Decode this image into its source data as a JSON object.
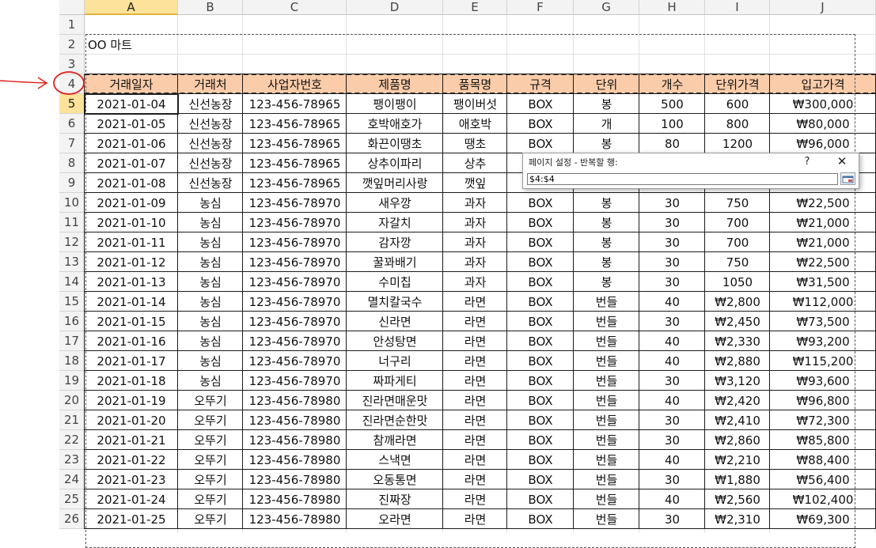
{
  "columns": [
    "A",
    "B",
    "C",
    "D",
    "E",
    "F",
    "G",
    "H",
    "I",
    "J"
  ],
  "rows": [
    "1",
    "2",
    "3",
    "4",
    "5",
    "6",
    "7",
    "8",
    "9",
    "10",
    "11",
    "12",
    "13",
    "14",
    "15",
    "16",
    "17",
    "18",
    "19",
    "20",
    "21",
    "22",
    "23",
    "24",
    "25",
    "26"
  ],
  "title_cell": "OO 마트",
  "table_headers": [
    "거래일자",
    "거래처",
    "사업자번호",
    "제품명",
    "품목명",
    "규격",
    "단위",
    "개수",
    "단위가격",
    "입고가격"
  ],
  "table_rows": [
    [
      "2021-01-04",
      "신선농장",
      "123-456-78965",
      "팽이팽이",
      "팽이버섯",
      "BOX",
      "봉",
      "500",
      "600",
      "₩300,000"
    ],
    [
      "2021-01-05",
      "신선농장",
      "123-456-78965",
      "호박애호가",
      "애호박",
      "BOX",
      "개",
      "100",
      "800",
      "₩80,000"
    ],
    [
      "2021-01-06",
      "신선농장",
      "123-456-78965",
      "화끈이땡초",
      "땡초",
      "BOX",
      "봉",
      "80",
      "1200",
      "₩96,000"
    ],
    [
      "2021-01-07",
      "신선농장",
      "123-456-78965",
      "상추이파리",
      "상추",
      "",
      "",
      "",
      "",
      ""
    ],
    [
      "2021-01-08",
      "신선농장",
      "123-456-78965",
      "깻잎머리사랑",
      "깻잎",
      "",
      "",
      "",
      "",
      ""
    ],
    [
      "2021-01-09",
      "농심",
      "123-456-78970",
      "새우깡",
      "과자",
      "BOX",
      "봉",
      "30",
      "750",
      "₩22,500"
    ],
    [
      "2021-01-10",
      "농심",
      "123-456-78970",
      "자갈치",
      "과자",
      "BOX",
      "봉",
      "30",
      "700",
      "₩21,000"
    ],
    [
      "2021-01-11",
      "농심",
      "123-456-78970",
      "감자깡",
      "과자",
      "BOX",
      "봉",
      "30",
      "700",
      "₩21,000"
    ],
    [
      "2021-01-12",
      "농심",
      "123-456-78970",
      "꿀꽈배기",
      "과자",
      "BOX",
      "봉",
      "30",
      "750",
      "₩22,500"
    ],
    [
      "2021-01-13",
      "농심",
      "123-456-78970",
      "수미칩",
      "과자",
      "BOX",
      "봉",
      "30",
      "1050",
      "₩31,500"
    ],
    [
      "2021-01-14",
      "농심",
      "123-456-78970",
      "멸치칼국수",
      "라면",
      "BOX",
      "번들",
      "40",
      "₩2,800",
      "₩112,000"
    ],
    [
      "2021-01-15",
      "농심",
      "123-456-78970",
      "신라면",
      "라면",
      "BOX",
      "번들",
      "30",
      "₩2,450",
      "₩73,500"
    ],
    [
      "2021-01-16",
      "농심",
      "123-456-78970",
      "안성탕면",
      "라면",
      "BOX",
      "번들",
      "40",
      "₩2,330",
      "₩93,200"
    ],
    [
      "2021-01-17",
      "농심",
      "123-456-78970",
      "너구리",
      "라면",
      "BOX",
      "번들",
      "40",
      "₩2,880",
      "₩115,200"
    ],
    [
      "2021-01-18",
      "농심",
      "123-456-78970",
      "짜파게티",
      "라면",
      "BOX",
      "번들",
      "30",
      "₩3,120",
      "₩93,600"
    ],
    [
      "2021-01-19",
      "오뚜기",
      "123-456-78980",
      "진라면매운맛",
      "라면",
      "BOX",
      "번들",
      "40",
      "₩2,420",
      "₩96,800"
    ],
    [
      "2021-01-20",
      "오뚜기",
      "123-456-78980",
      "진라면순한맛",
      "라면",
      "BOX",
      "번들",
      "30",
      "₩2,410",
      "₩72,300"
    ],
    [
      "2021-01-21",
      "오뚜기",
      "123-456-78980",
      "참깨라면",
      "라면",
      "BOX",
      "번들",
      "30",
      "₩2,860",
      "₩85,800"
    ],
    [
      "2021-01-22",
      "오뚜기",
      "123-456-78980",
      "스낵면",
      "라면",
      "BOX",
      "번들",
      "40",
      "₩2,210",
      "₩88,400"
    ],
    [
      "2021-01-23",
      "오뚜기",
      "123-456-78980",
      "오동통면",
      "라면",
      "BOX",
      "번들",
      "30",
      "₩1,880",
      "₩56,400"
    ],
    [
      "2021-01-24",
      "오뚜기",
      "123-456-78980",
      "진짜장",
      "라면",
      "BOX",
      "번들",
      "40",
      "₩2,560",
      "₩102,400"
    ],
    [
      "2021-01-25",
      "오뚜기",
      "123-456-78980",
      "오라면",
      "라면",
      "BOX",
      "번들",
      "30",
      "₩2,310",
      "₩69,300"
    ]
  ],
  "dialog": {
    "title": "페이지 설정 - 반복할 행:",
    "help_label": "?",
    "close_label": "✕",
    "range_value": "$4:$4",
    "collapse_icon": "range-collapse-icon"
  },
  "colors": {
    "header_fill": "#fbcca9",
    "selected_header": "#fce29a",
    "annotation": "#e0201b"
  }
}
